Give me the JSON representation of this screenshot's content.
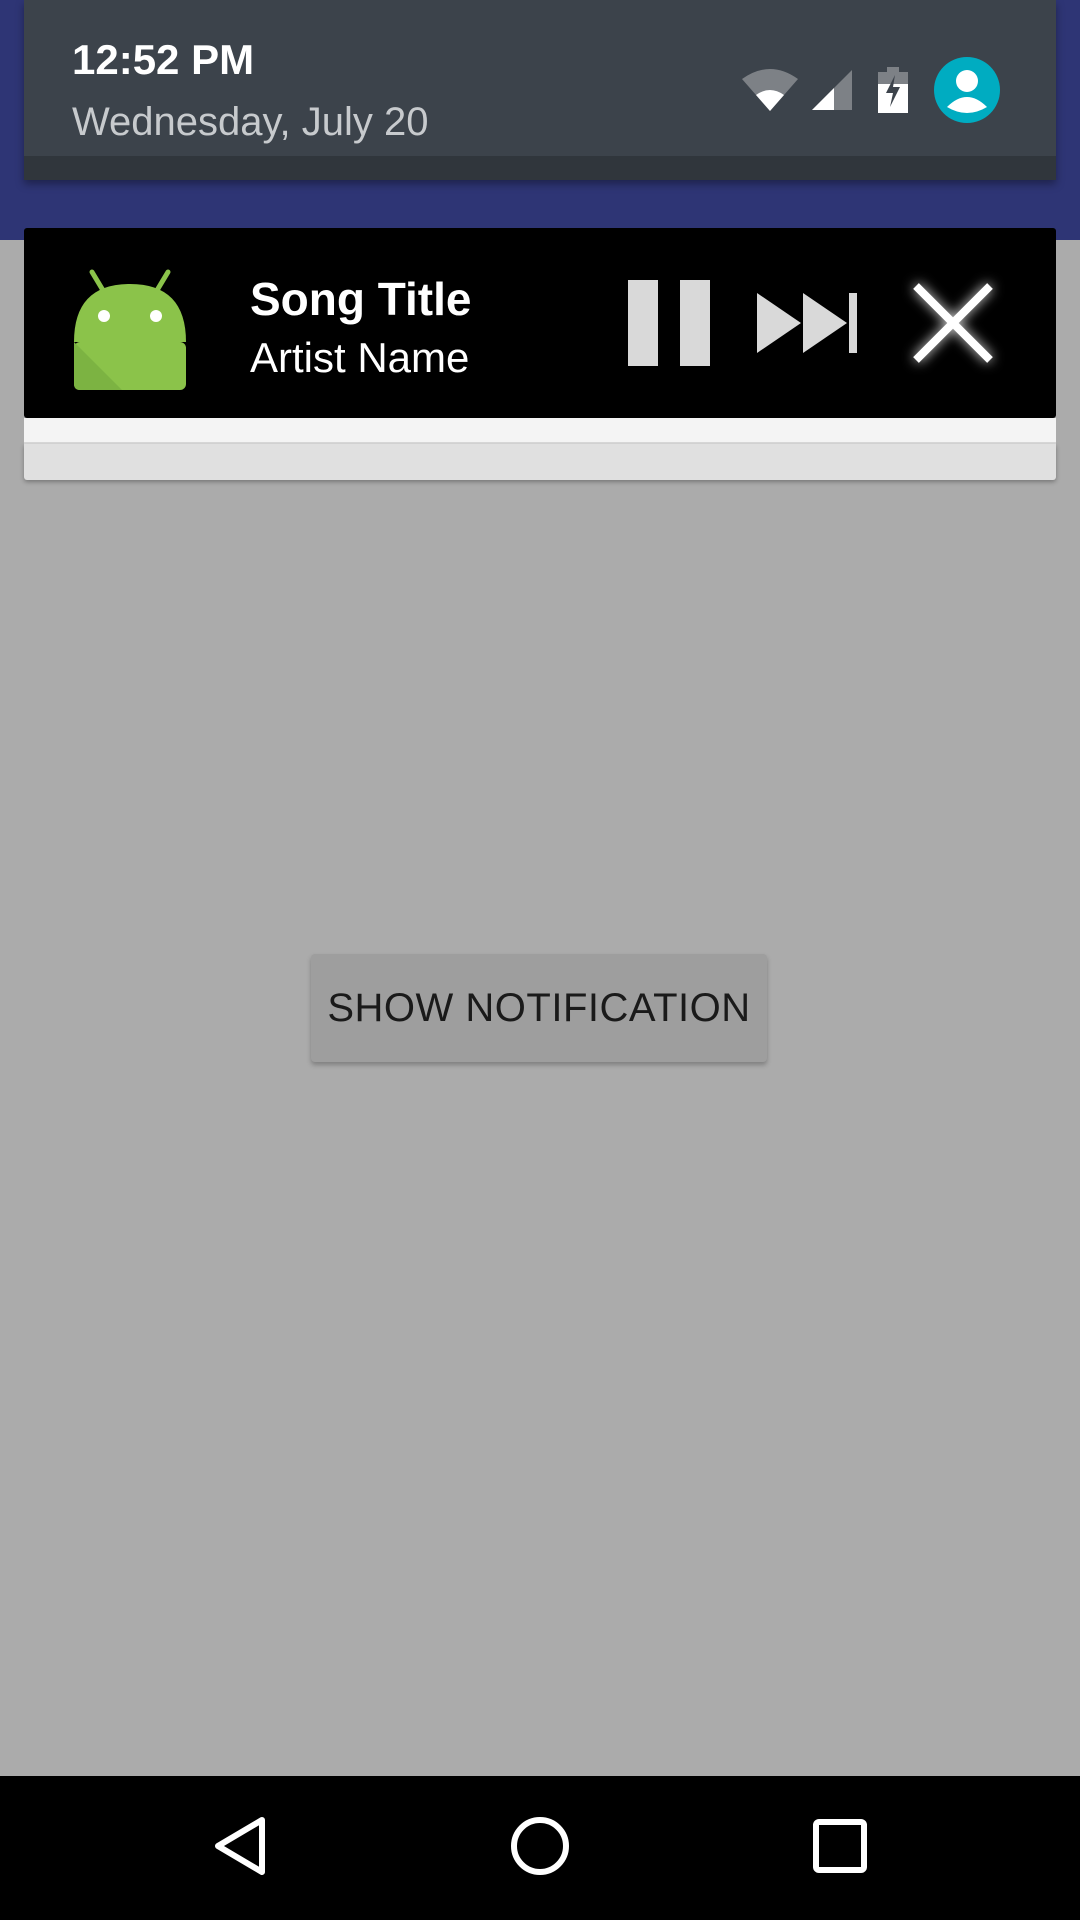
{
  "status": {
    "time": "12:52 PM",
    "date": "Wednesday, July 20",
    "icons": [
      "wifi-icon",
      "cell-signal-icon",
      "battery-charging-icon",
      "user-avatar-icon"
    ]
  },
  "notification": {
    "app_icon": "android-robot-icon",
    "song_title": "Song Title",
    "artist_name": "Artist Name",
    "controls": [
      "pause-icon",
      "skip-next-icon",
      "close-icon"
    ]
  },
  "main": {
    "show_button_label": "SHOW NOTIFICATION"
  },
  "navigation": {
    "buttons": [
      "back-icon",
      "home-icon",
      "recents-icon"
    ]
  },
  "colors": {
    "app_bar": "#2e3575",
    "shade_header": "#3c434b",
    "scrim": "#ababab",
    "android_green": "#8bc34a",
    "avatar": "#00acc1"
  }
}
